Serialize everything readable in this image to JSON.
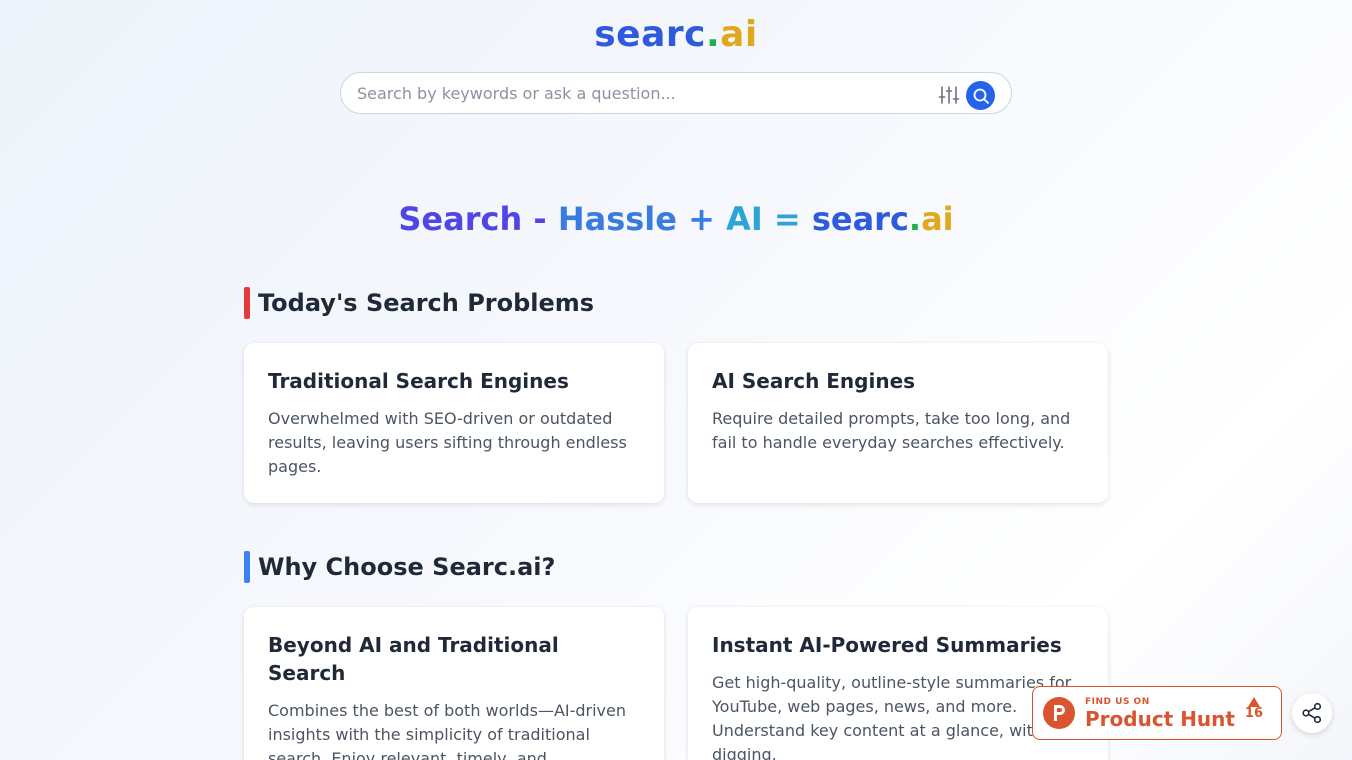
{
  "brand": {
    "logo_part1": "searc",
    "logo_dot": ".",
    "logo_part2": "ai"
  },
  "search": {
    "placeholder": "Search by keywords or ask a question...",
    "value": "",
    "filter_icon": "sliders-icon",
    "submit_icon": "search-icon"
  },
  "hero": {
    "part_search": "Search",
    "part_minus": " - ",
    "part_hassle": "Hassle",
    "part_plus": " + ",
    "part_ai": "AI",
    "part_equals": " = ",
    "brand_part1": "searc",
    "brand_dot": ".",
    "brand_part2": "ai"
  },
  "problems": {
    "title": "Today's Search Problems",
    "cards": [
      {
        "title": "Traditional Search Engines",
        "text": "Overwhelmed with SEO-driven or outdated results, leaving users sifting through endless pages."
      },
      {
        "title": "AI Search Engines",
        "text": "Require detailed prompts, take too long, and fail to handle everyday searches effectively."
      }
    ]
  },
  "why": {
    "title": "Why Choose Searc.ai?",
    "cards": [
      {
        "title": "Beyond AI and Traditional Search",
        "text": "Combines the best of both worlds—AI-driven insights with the simplicity of traditional search. Enjoy relevant, timely, and"
      },
      {
        "title": "Instant AI-Powered Summaries",
        "text": "Get high-quality, outline-style summaries for YouTube, web pages, news, and more. Understand key content at a glance, without digging."
      }
    ]
  },
  "product_hunt": {
    "small_label": "FIND US ON",
    "big_label": "Product Hunt",
    "votes": "16",
    "logo_letter": "P"
  },
  "share": {
    "icon": "share-icon"
  },
  "colors": {
    "brand_blue": "#2e5bdc",
    "brand_green": "#22b04a",
    "brand_gold": "#e0a81c",
    "accent_red": "#e23b3b",
    "accent_blue": "#3b82f6",
    "product_hunt": "#da552f"
  }
}
